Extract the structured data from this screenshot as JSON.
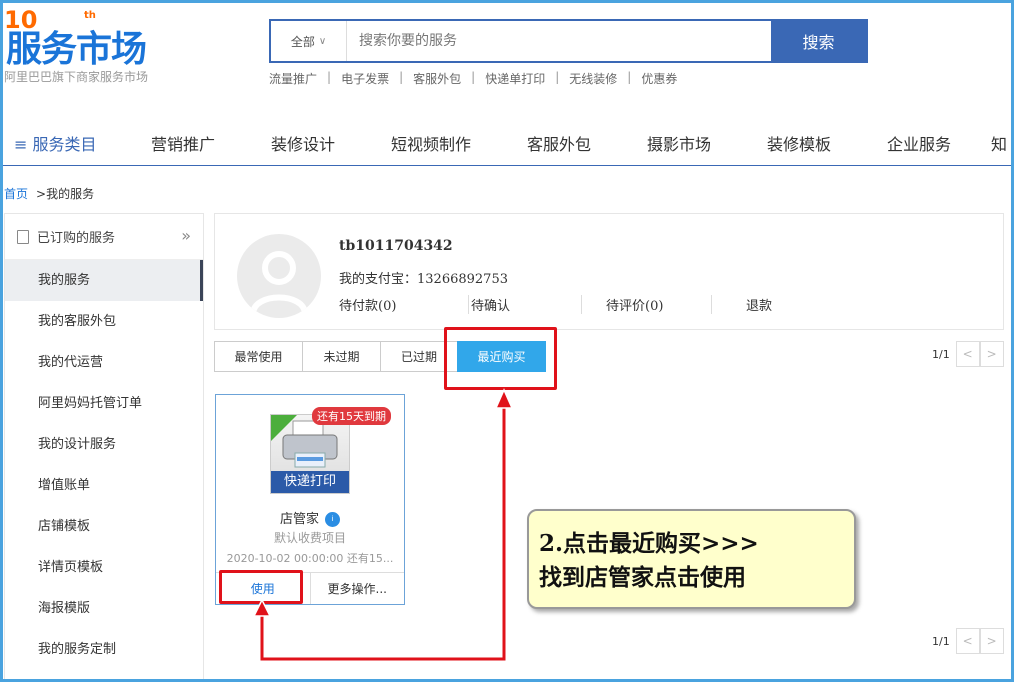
{
  "logo": {
    "number": "10",
    "suffix": "th",
    "title": "服务市场",
    "subtitle": "阿里巴巴旗下商家服务市场"
  },
  "search": {
    "category": "全部",
    "placeholder": "搜索你要的服务",
    "button": "搜索",
    "hot_links": [
      "流量推广",
      "电子发票",
      "客服外包",
      "快递单打印",
      "无线装修",
      "优惠券"
    ]
  },
  "nav": {
    "items": [
      "≡ 服务类目",
      "营销推广",
      "装修设计",
      "短视频制作",
      "客服外包",
      "摄影市场",
      "装修模板",
      "企业服务",
      "知"
    ]
  },
  "breadcrumb": {
    "home": "首页",
    "current": ">我的服务"
  },
  "sidebar": {
    "header": "已订购的服务",
    "items": [
      "我的服务",
      "我的客服外包",
      "我的代运营",
      "阿里妈妈托管订单",
      "我的设计服务",
      "增值账单",
      "店铺模板",
      "详情页模板",
      "海报模版",
      "我的服务定制"
    ],
    "active_index": 0
  },
  "user": {
    "name": "tb1011704342",
    "alipay": "我的支付宝：13266892753",
    "stats": [
      "待付款(0)",
      "待确认",
      "待评价(0)",
      "退款"
    ]
  },
  "tabs": {
    "items": [
      "最常使用",
      "未过期",
      "已过期",
      "最近购买"
    ],
    "active_index": 3
  },
  "pager": {
    "text": "1/1"
  },
  "service_card": {
    "icon_label": "快递打印",
    "badge": "还有15天到期",
    "name": "店管家",
    "subtitle": "默认收费项目",
    "date": "2020-10-02 00:00:00 还有15...",
    "use_button": "使用",
    "more_button": "更多操作..."
  },
  "annotation": {
    "line1": "2.点击最近购买>>>",
    "line2": "找到店管家点击使用"
  },
  "colors": {
    "brand_blue": "#3a68b5",
    "active_tab": "#31a7ea",
    "highlight_red": "#e0121a",
    "note_bg": "#ffffcc"
  }
}
